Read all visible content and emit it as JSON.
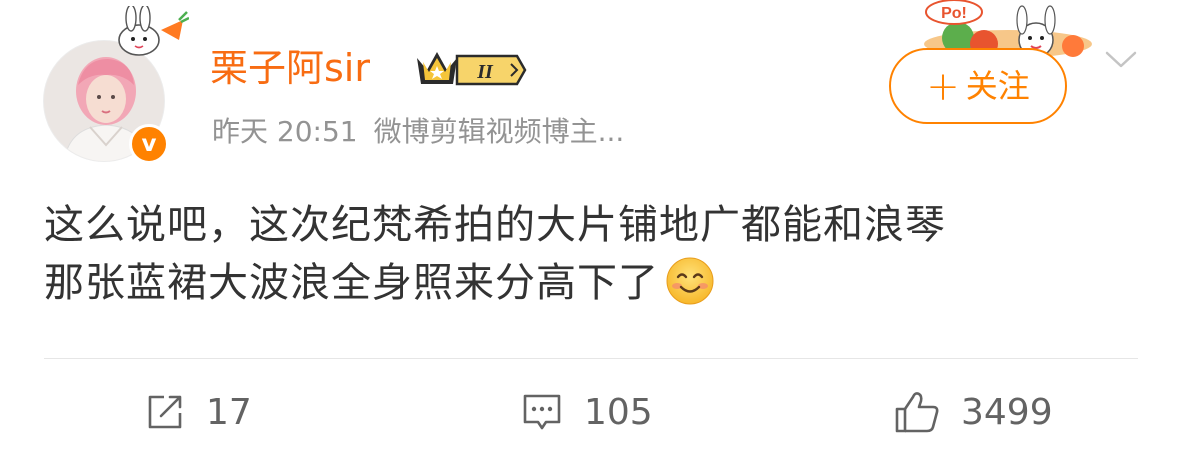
{
  "post": {
    "username": "栗子阿sir",
    "member_level": "II",
    "time": "昨天 20:51",
    "source": "微博剪辑视频博主...",
    "verified_mark": "v",
    "follow_label": "关注",
    "follow_plus": "+",
    "text_line1": "这么说吧，这次纪梵希拍的大片铺地广都能和浪琴",
    "text_line2": "那张蓝裙大波浪全身照来分高下了",
    "emoji": "smiling-face-emoji"
  },
  "actions": {
    "reposts": "17",
    "comments": "105",
    "likes": "3499"
  },
  "decor": {
    "card_bubble_text": "Po!"
  },
  "colors": {
    "username": "#f86c12",
    "accent": "#ff8200",
    "meta": "#939393",
    "body_text": "#333333",
    "action": "#636363",
    "divider": "#e6e6e6",
    "crown_gold": "#f5c53a",
    "crown_dark": "#2b2b2b"
  }
}
